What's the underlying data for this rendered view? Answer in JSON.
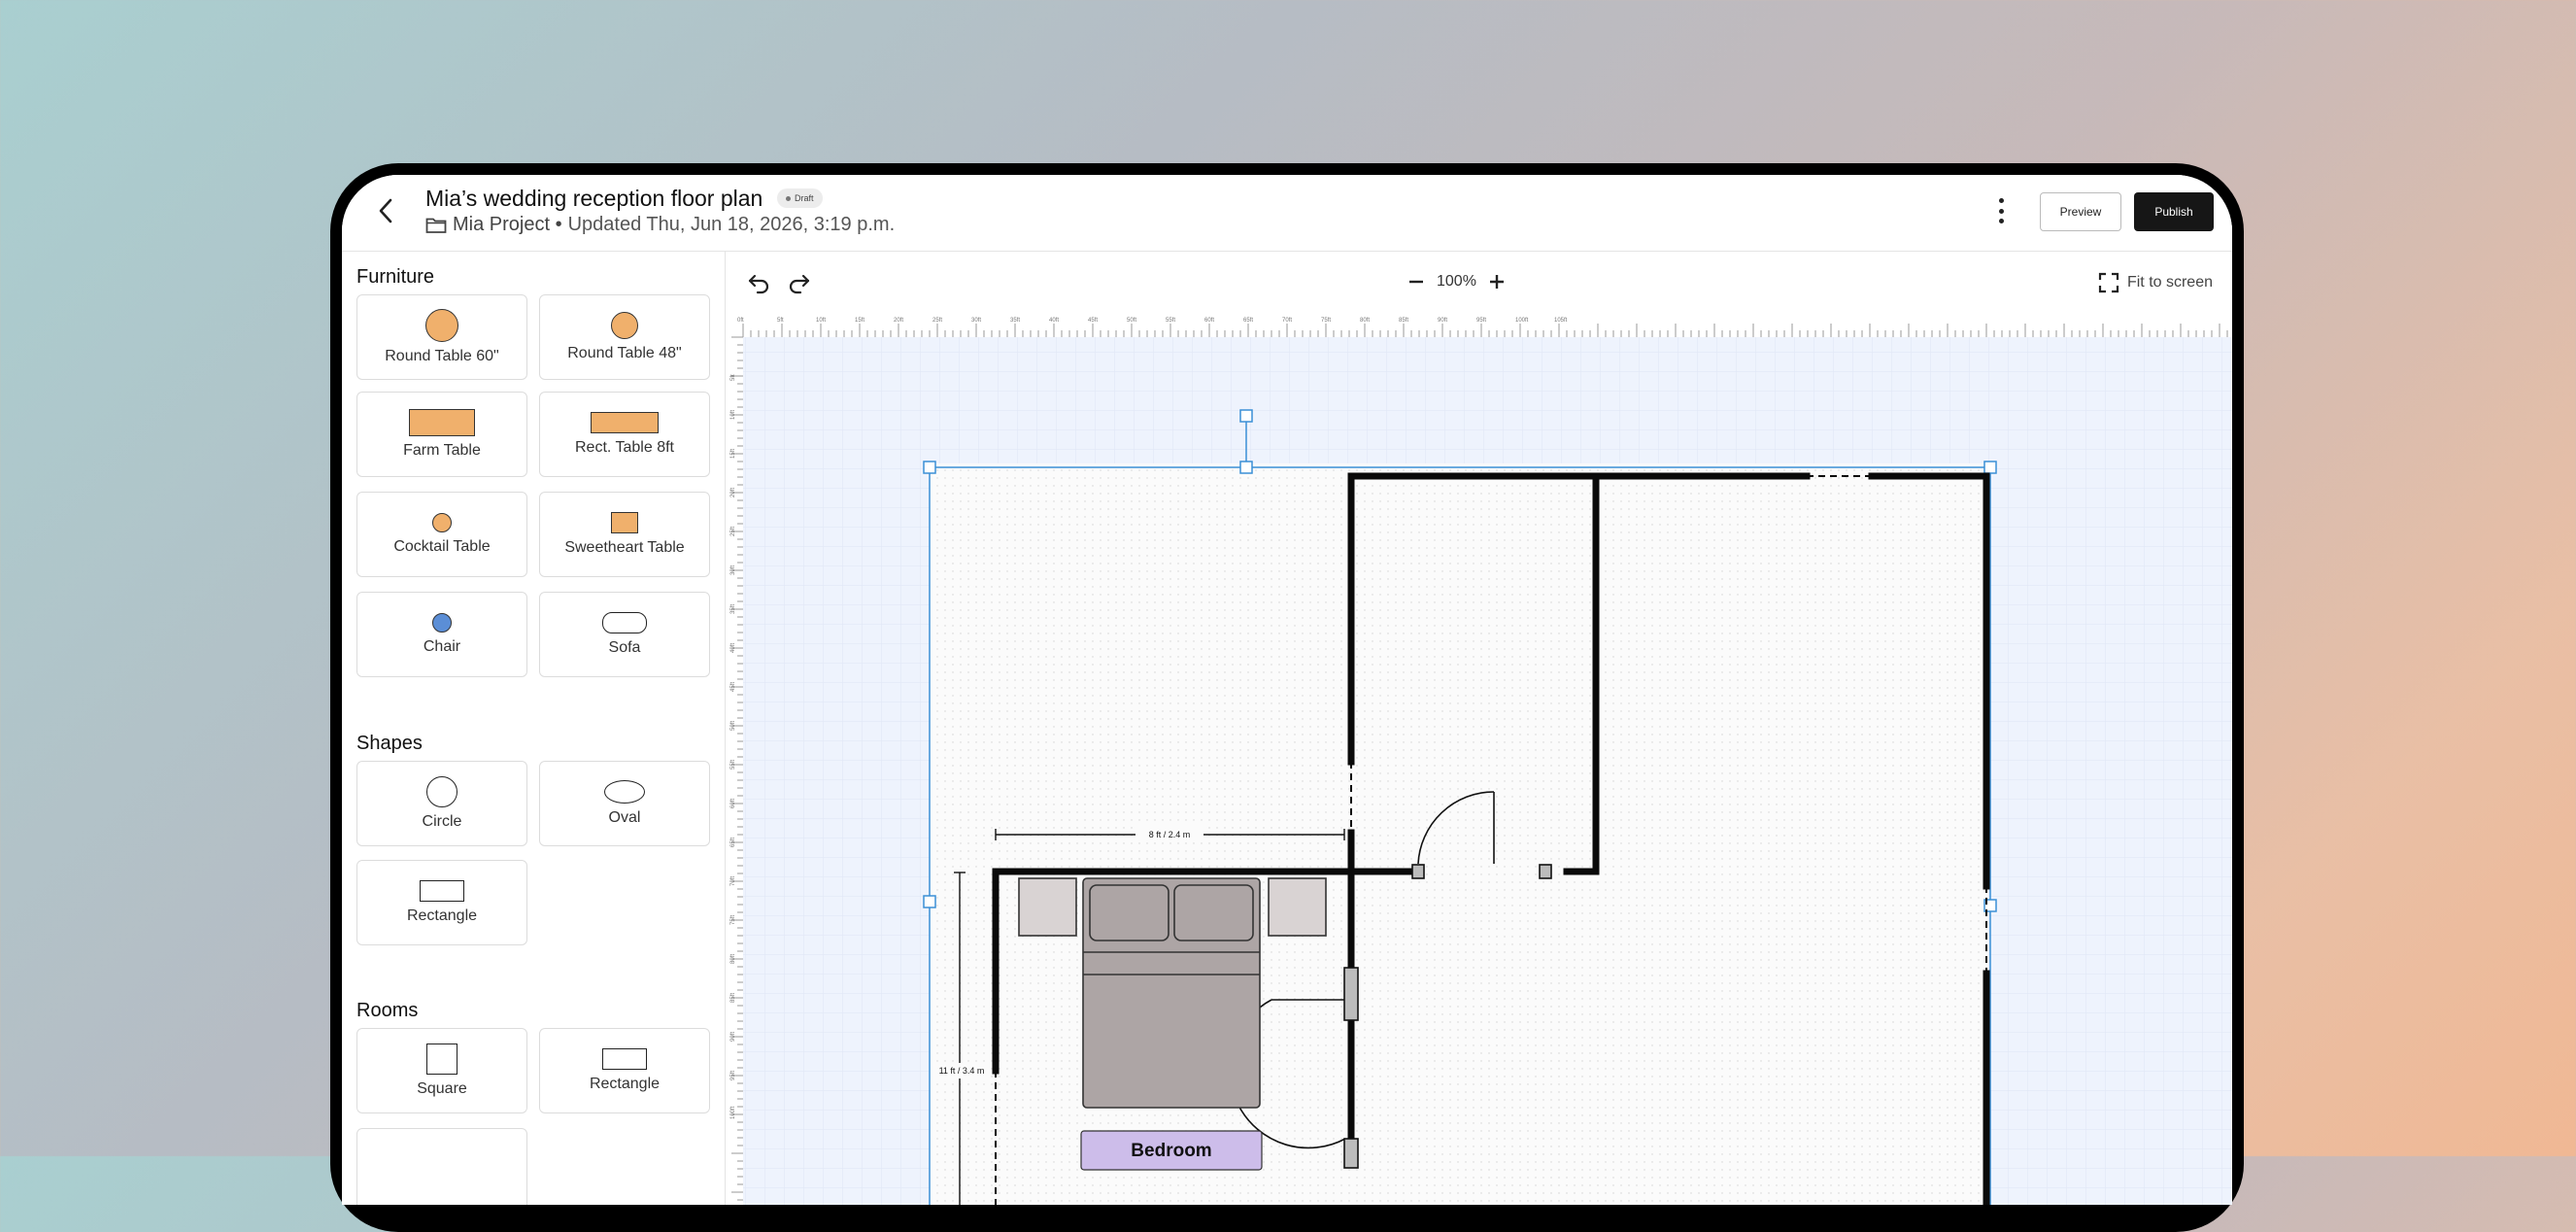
{
  "header": {
    "title": "Mia’s wedding reception floor plan",
    "badge": "Draft",
    "project": "Mia Project •",
    "updated": "Updated Thu, Jun 18, 2026, 3:19 p.m.",
    "preview_label": "Preview",
    "publish_label": "Publish"
  },
  "sidebar": {
    "furniture_title": "Furniture",
    "furniture": [
      {
        "label": "Round Table 60\"",
        "icon": "round-table-icon"
      },
      {
        "label": "Round Table 48\"",
        "icon": "round-table-icon"
      },
      {
        "label": "Farm Table",
        "icon": "farm-table-icon"
      },
      {
        "label": "Rect. Table 8ft",
        "icon": "rect-table-icon"
      },
      {
        "label": "Cocktail Table",
        "icon": "cocktail-table-icon"
      },
      {
        "label": "Sweetheart Table",
        "icon": "sweetheart-table-icon"
      },
      {
        "label": "Chair",
        "icon": "chair-icon"
      },
      {
        "label": "Sofa",
        "icon": "sofa-icon"
      }
    ],
    "shapes_title": "Shapes",
    "shapes": [
      {
        "label": "Circle",
        "icon": "circle-icon"
      },
      {
        "label": "Oval",
        "icon": "oval-icon"
      },
      {
        "label": "Rectangle",
        "icon": "rectangle-icon"
      }
    ],
    "rooms_title": "Rooms",
    "rooms": [
      {
        "label": "Square",
        "icon": "square-room-icon"
      },
      {
        "label": "Rectangle",
        "icon": "rectangle-room-icon"
      }
    ]
  },
  "toolbar": {
    "zoom_level": "100%",
    "fit_label": "Fit to screen"
  },
  "canvas": {
    "ruler_h_labels": [
      "0ft",
      "5ft",
      "10ft",
      "15ft",
      "20ft",
      "25ft",
      "30ft",
      "35ft",
      "40ft",
      "45ft",
      "50ft",
      "55ft",
      "60ft",
      "65ft",
      "70ft",
      "75ft",
      "80ft",
      "85ft",
      "90ft",
      "95ft",
      "100ft",
      "105ft"
    ],
    "ruler_v_labels": [
      "5ft",
      "10ft",
      "15ft",
      "20ft",
      "25ft",
      "30ft",
      "35ft",
      "40ft",
      "45ft",
      "50ft",
      "55ft",
      "60ft",
      "65ft",
      "70ft",
      "75ft",
      "80ft",
      "85ft",
      "90ft",
      "95ft",
      "100ft"
    ],
    "dim_width": "8 ft / 2.4 m",
    "dim_height": "11 ft / 3.4 m",
    "room_label": "Bedroom"
  },
  "colors": {
    "accent": "#3a8fd6",
    "furniture_orange": "#f0b06c",
    "chair_blue": "#5b8ed6",
    "room_label_bg": "#cdbdea",
    "publish_bg": "#161616"
  }
}
